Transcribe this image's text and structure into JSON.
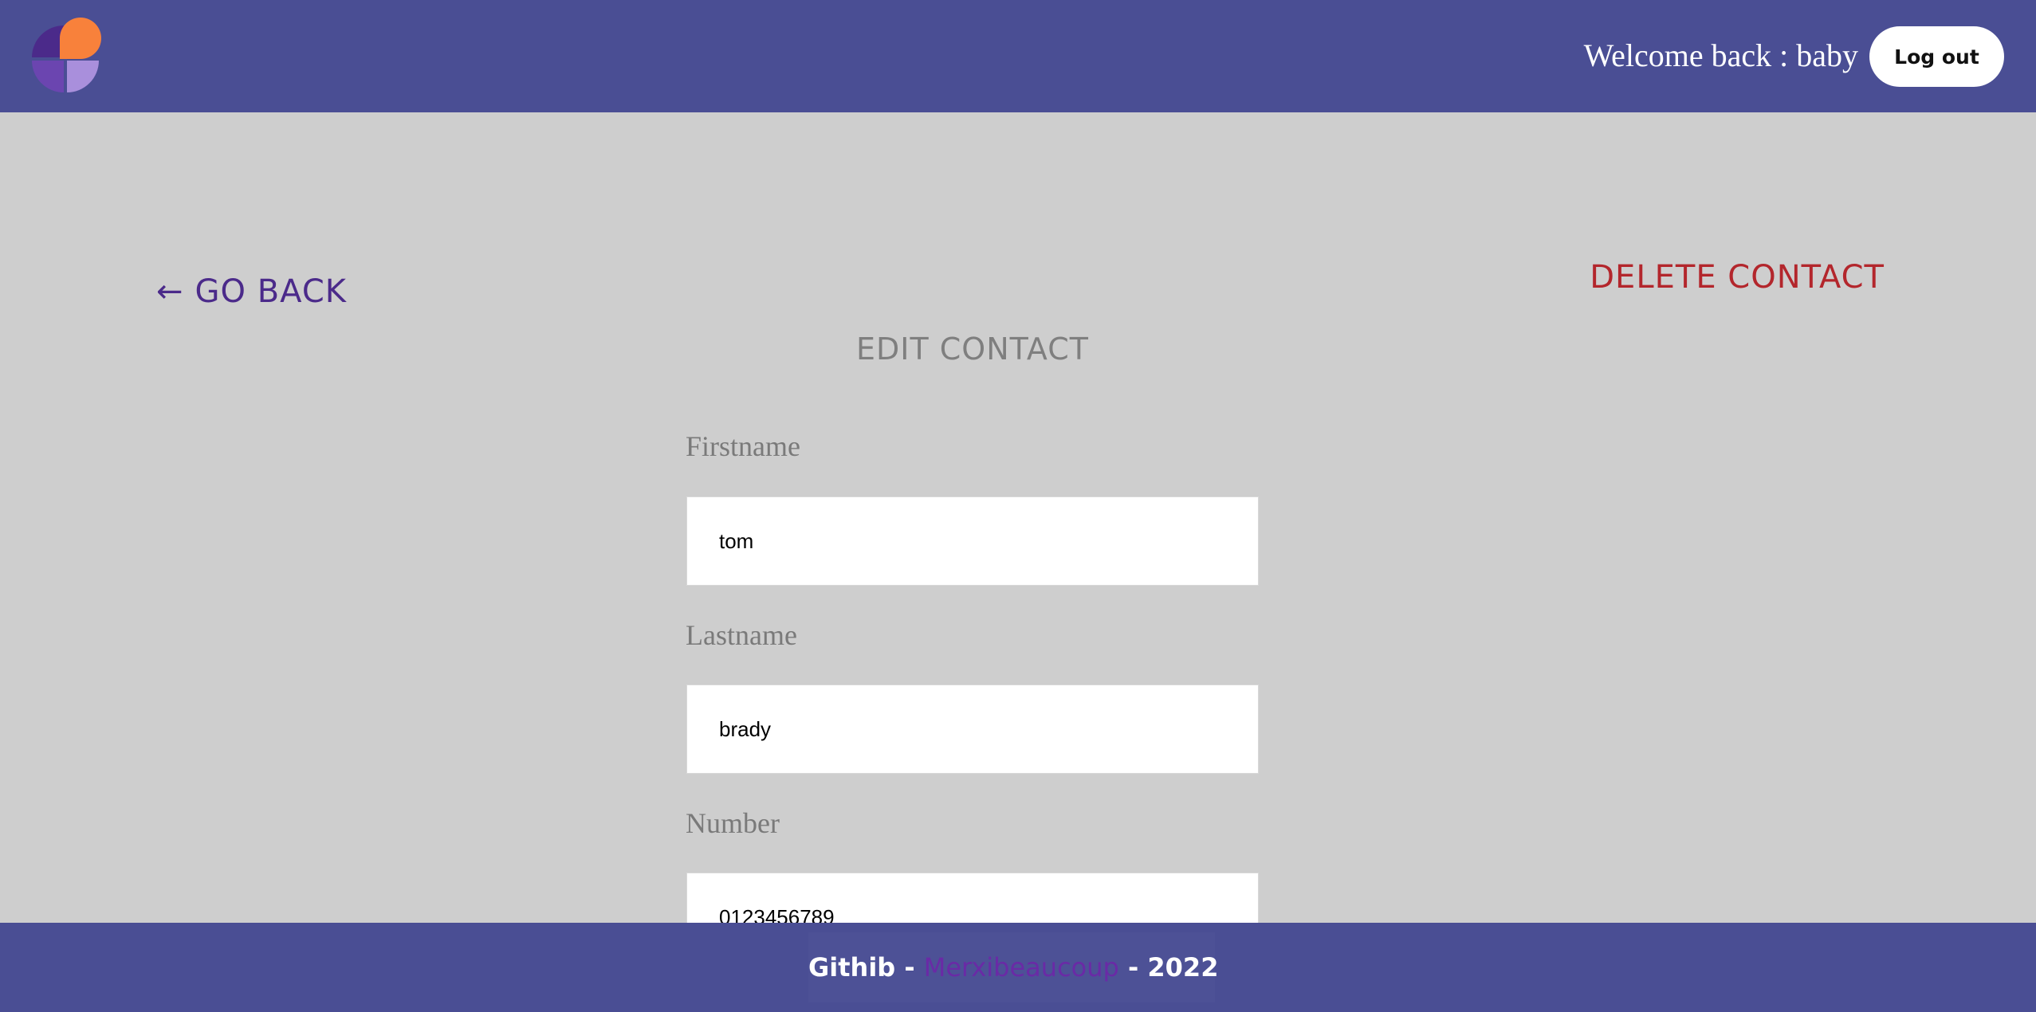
{
  "header": {
    "logo_icon": "app-logo-icon",
    "welcome_prefix": "Welcome back : ",
    "username": "baby",
    "logout_label": "Log out"
  },
  "nav": {
    "go_back_arrow": "←",
    "go_back_label": "GO BACK",
    "delete_label": "DELETE CONTACT"
  },
  "form": {
    "title": "EDIT CONTACT",
    "fields": [
      {
        "label": "Firstname",
        "value": "tom"
      },
      {
        "label": "Lastname",
        "value": "brady"
      },
      {
        "label": "Number",
        "value": "0123456789"
      }
    ]
  },
  "footer": {
    "prefix": "Githib - ",
    "link_text": "Merxibeaucoup",
    "suffix": " - 2022"
  },
  "colors": {
    "header_bg": "#4a4e94",
    "page_bg": "#cecece",
    "go_back": "#4b2a8a",
    "delete": "#b3262c",
    "logo_orange": "#f8813b",
    "logo_dark_purple": "#4b2a8a",
    "logo_mid_purple": "#6b45b0",
    "logo_light_purple": "#a98fdc"
  }
}
